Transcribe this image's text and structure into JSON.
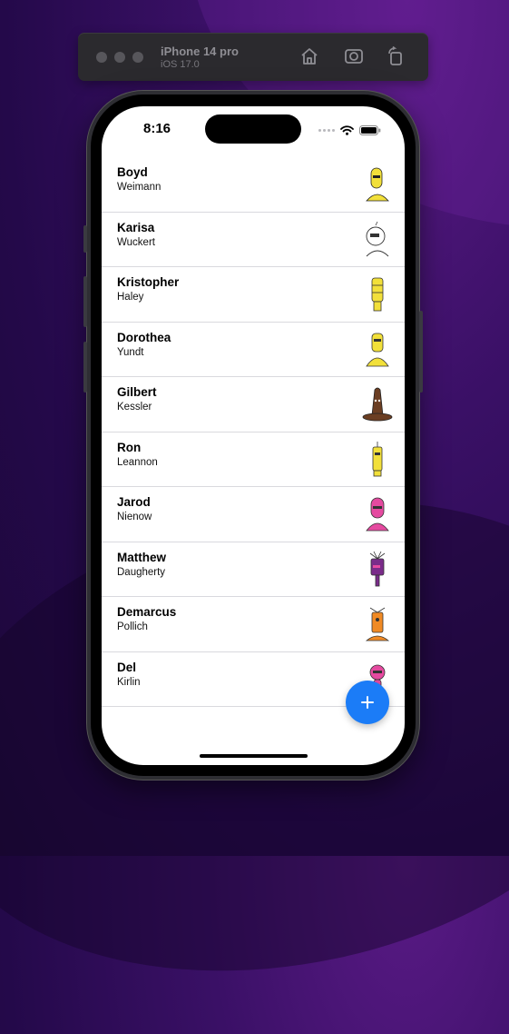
{
  "simulator": {
    "device_name": "iPhone 14 pro",
    "os_version": "iOS 17.0",
    "icons": [
      "home-icon",
      "screenshot-icon",
      "rotate-icon"
    ]
  },
  "status_bar": {
    "time": "8:16",
    "icons": [
      "signal-dots-icon",
      "wifi-icon",
      "battery-icon"
    ]
  },
  "contacts": [
    {
      "first": "Boyd",
      "last": "Weimann",
      "avatar_color": "#f2e03a"
    },
    {
      "first": "Karisa",
      "last": "Wuckert",
      "avatar_color": "#ffffff"
    },
    {
      "first": "Kristopher",
      "last": "Haley",
      "avatar_color": "#f2e03a"
    },
    {
      "first": "Dorothea",
      "last": "Yundt",
      "avatar_color": "#f2e03a"
    },
    {
      "first": "Gilbert",
      "last": "Kessler",
      "avatar_color": "#6b3e22"
    },
    {
      "first": "Ron",
      "last": "Leannon",
      "avatar_color": "#f2e03a"
    },
    {
      "first": "Jarod",
      "last": "Nienow",
      "avatar_color": "#e54aa0"
    },
    {
      "first": "Matthew",
      "last": "Daugherty",
      "avatar_color": "#7a2c8a"
    },
    {
      "first": "Demarcus",
      "last": "Pollich",
      "avatar_color": "#f08a24"
    },
    {
      "first": "Del",
      "last": "Kirlin",
      "avatar_color": "#e54aa0"
    }
  ],
  "fab": {
    "label": "+",
    "color": "#1b7cf7"
  }
}
